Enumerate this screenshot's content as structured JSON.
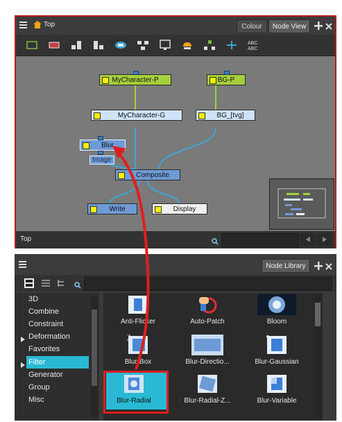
{
  "node_view": {
    "breadcrumb": "Top",
    "tabs": [
      "Colour",
      "Node View"
    ],
    "footer_label": "Top",
    "nodes": {
      "mycharacter_p": "MyCharacter-P",
      "bg_p": "BG-P",
      "mycharacter_g": "MyCharacter-G",
      "bg_tvg": "BG_[tvg]",
      "blur": "Blur",
      "image_label": "Image",
      "composite": "Composite",
      "write": "Write",
      "display": "Display"
    }
  },
  "node_library": {
    "tab": "Node Library",
    "categories": [
      "3D",
      "Combine",
      "Constraint",
      "Deformation",
      "Favorites",
      "Filter",
      "Generator",
      "Group",
      "Misc"
    ],
    "selected_category": "Filter",
    "items": [
      "Anti-Flicker",
      "Auto-Patch",
      "Bloom",
      "Blur-Box",
      "Blur-Directio...",
      "Blur-Gaussian",
      "Blur-Radial",
      "Blur-Radial-Z...",
      "Blur-Variable"
    ],
    "selected_item": "Blur-Radial"
  },
  "colors": {
    "accent": "#29b9d4",
    "highlight": "#e01e1e",
    "node_green": "#a6cf3d",
    "node_blue": "#6e9ad6"
  }
}
